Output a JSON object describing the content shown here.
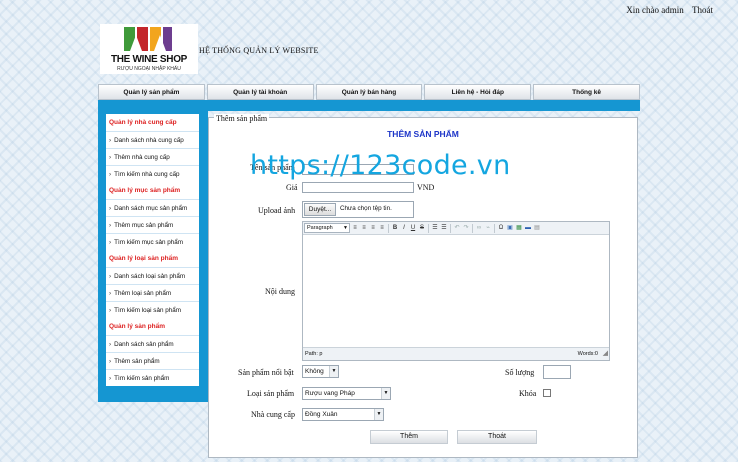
{
  "topbar": {
    "greeting": "Xin chào admin",
    "logout": "Thoát"
  },
  "logo": {
    "name": "THE WINE SHOP",
    "tagline": "RƯỢU NGOẠI NHẬP KHẨU"
  },
  "site_title": "HỆ THỐNG QUẢN LÝ WEBSITE",
  "menu": [
    "Quản lý sản phẩm",
    "Quản lý tài khoản",
    "Quản lý bán hàng",
    "Liên hệ - Hỏi đáp",
    "Thống kê"
  ],
  "sidebar": {
    "groups": [
      {
        "title": "Quản lý nhà cung cấp",
        "items": [
          "Danh sách nhà cung cấp",
          "Thêm nhà cung cấp",
          "Tìm kiếm nhà cung cấp"
        ]
      },
      {
        "title": "Quản lý mục sản phẩm",
        "items": [
          "Danh sách mục sản phẩm",
          "Thêm mục sản phẩm",
          "Tìm kiếm mục sản phẩm"
        ]
      },
      {
        "title": "Quản lý loại sản phẩm",
        "items": [
          "Danh sách loại sản phẩm",
          "Thêm loại sản phẩm",
          "Tìm kiếm loại sản phẩm"
        ]
      },
      {
        "title": "Quản lý sản phẩm",
        "items": [
          "Danh sách sản phẩm",
          "Thêm sản phẩm",
          "Tìm kiếm sản phẩm"
        ]
      }
    ]
  },
  "form": {
    "legend": "Thêm sản phẩm",
    "title": "THÊM SẢN PHẨM",
    "name_label": "Tên sản phẩm",
    "name_value": "",
    "price_label": "Giá",
    "price_value": "",
    "price_unit": "VND",
    "upload_label": "Upload ảnh",
    "upload_button": "Duyệt...",
    "upload_status": "Chưa chọn tệp tin.",
    "content_label": "Nội dung",
    "editor": {
      "format": "Paragraph",
      "path": "Path: p",
      "words": "Words:0"
    },
    "featured_label": "Sản phẩm nổi bật",
    "featured_value": "Không",
    "quantity_label": "Số lượng",
    "quantity_value": "",
    "category_label": "Loại sản phẩm",
    "category_value": "Rượu vang Pháp",
    "lock_label": "Khóa",
    "lock_checked": false,
    "supplier_label": "Nhà cung cấp",
    "supplier_value": "Đồng Xuân",
    "submit_button": "Thêm",
    "exit_button": "Thoát"
  },
  "watermark": "https://123code.vn",
  "colors": {
    "accent": "#1596d2",
    "section_title": "#dd2222",
    "form_title": "#1d35c8",
    "watermark": "#14a6e0"
  }
}
